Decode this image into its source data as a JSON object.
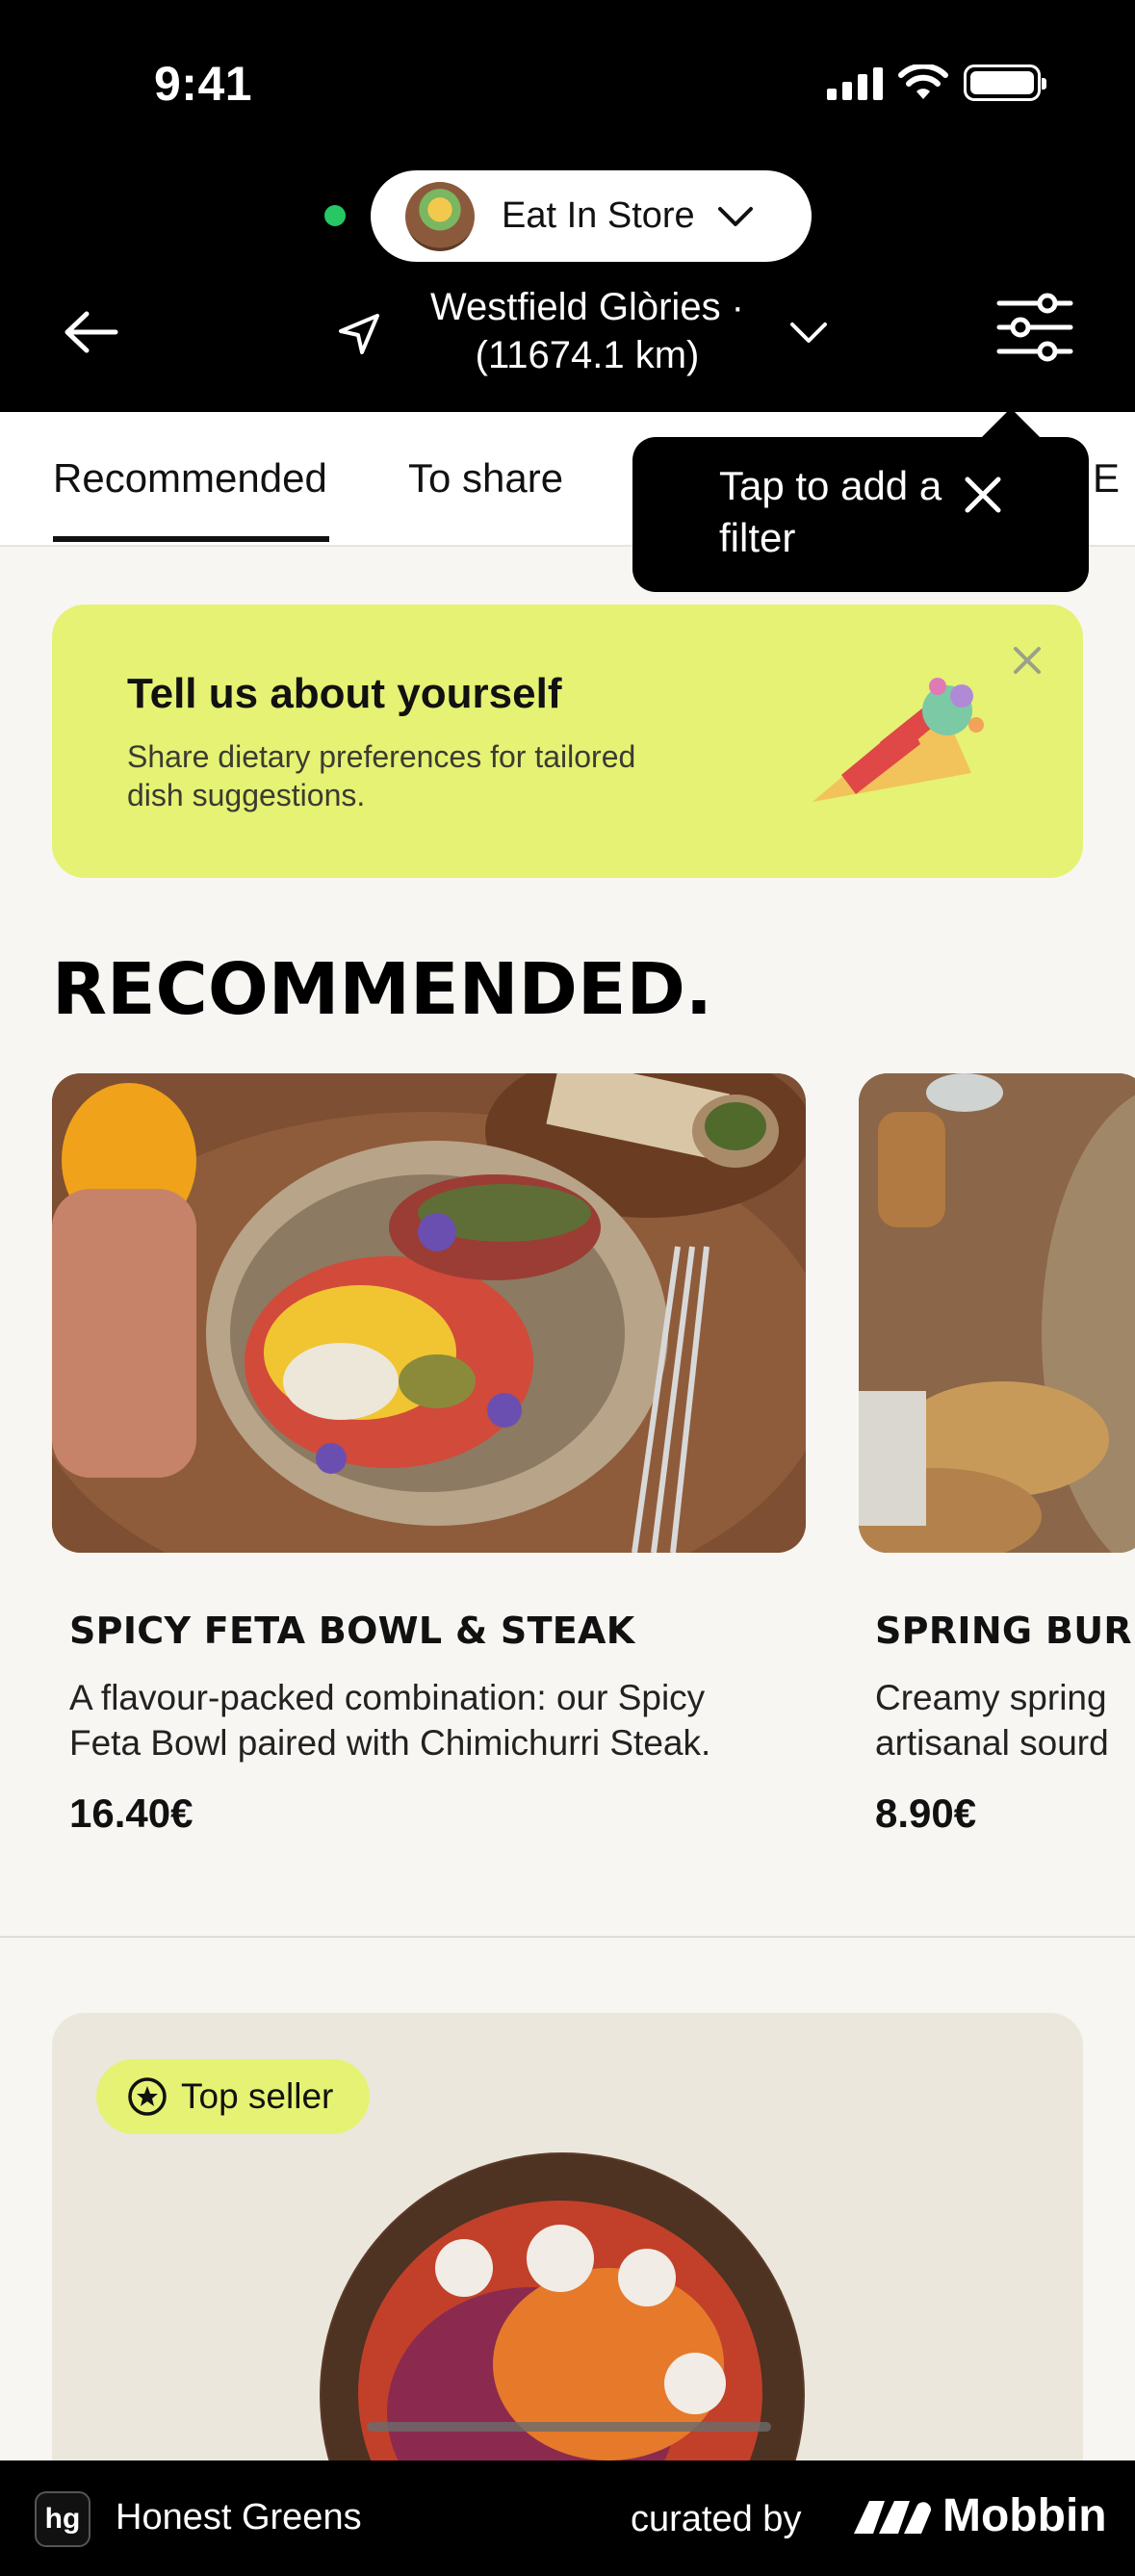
{
  "status_bar": {
    "time": "9:41"
  },
  "header": {
    "mode_label": "Eat In Store",
    "store_name": "Westfield Glòries ·",
    "store_distance": "(11674.1 km)"
  },
  "tabs": [
    "Recommended",
    "To share"
  ],
  "tooltip": {
    "text": "Tap to add a filter"
  },
  "promo": {
    "title": "Tell us about yourself",
    "subtitle": "Share dietary preferences for tailored dish suggestions."
  },
  "section": {
    "title": "RECOMMENDED."
  },
  "dishes": [
    {
      "title": "SPICY FETA BOWL & STEAK",
      "desc_line1": "A flavour-packed combination: our Spicy",
      "desc_line2": "Feta Bowl paired with Chimichurri Steak.",
      "price": "16.40€"
    },
    {
      "title": "SPRING BURR",
      "desc_line1": "Creamy spring",
      "desc_line2": "artisanal sourd",
      "price": "8.90€"
    }
  ],
  "feature": {
    "badge": "Top seller"
  },
  "footer": {
    "app_icon": "hg",
    "app_name": "Honest Greens",
    "curated_by": "curated by",
    "brand": "Mobbin"
  },
  "colors": {
    "header_bg": "#000000",
    "accent_lime": "#e5f274",
    "online_dot": "#27c763",
    "page_bg": "#f7f6f2"
  }
}
